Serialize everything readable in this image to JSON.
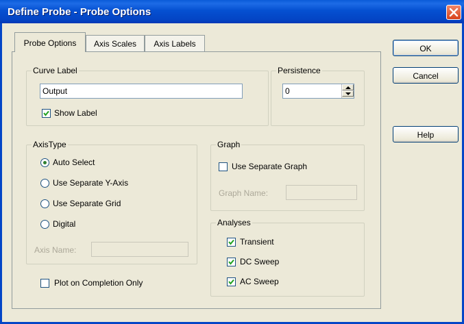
{
  "window": {
    "title": "Define Probe - Probe Options"
  },
  "tabs": [
    {
      "label": "Probe Options"
    },
    {
      "label": "Axis Scales"
    },
    {
      "label": "Axis Labels"
    }
  ],
  "curve_label": {
    "group_label": "Curve Label",
    "value": "Output",
    "show_label": {
      "label": "Show Label",
      "checked": true
    }
  },
  "persistence": {
    "group_label": "Persistence",
    "value": "0"
  },
  "axis_type": {
    "group_label": "AxisType",
    "options": [
      {
        "label": "Auto Select",
        "selected": true
      },
      {
        "label": "Use Separate Y-Axis",
        "selected": false
      },
      {
        "label": "Use Separate Grid",
        "selected": false
      },
      {
        "label": "Digital",
        "selected": false
      }
    ],
    "axis_name_label": "Axis Name:",
    "axis_name_value": ""
  },
  "graph": {
    "group_label": "Graph",
    "use_separate_graph": {
      "label": "Use Separate Graph",
      "checked": false
    },
    "graph_name_label": "Graph Name:",
    "graph_name_value": ""
  },
  "analyses": {
    "group_label": "Analyses",
    "items": [
      {
        "label": "Transient",
        "checked": true
      },
      {
        "label": "DC Sweep",
        "checked": true
      },
      {
        "label": "AC Sweep",
        "checked": true
      }
    ]
  },
  "plot_on_completion": {
    "label": "Plot on Completion Only",
    "checked": false
  },
  "buttons": {
    "ok": "OK",
    "cancel": "Cancel",
    "help": "Help"
  },
  "colors": {
    "title_bar": "#0550d1",
    "dialog_bg": "#ece9d8",
    "radio_dot": "#2f7f2f"
  }
}
